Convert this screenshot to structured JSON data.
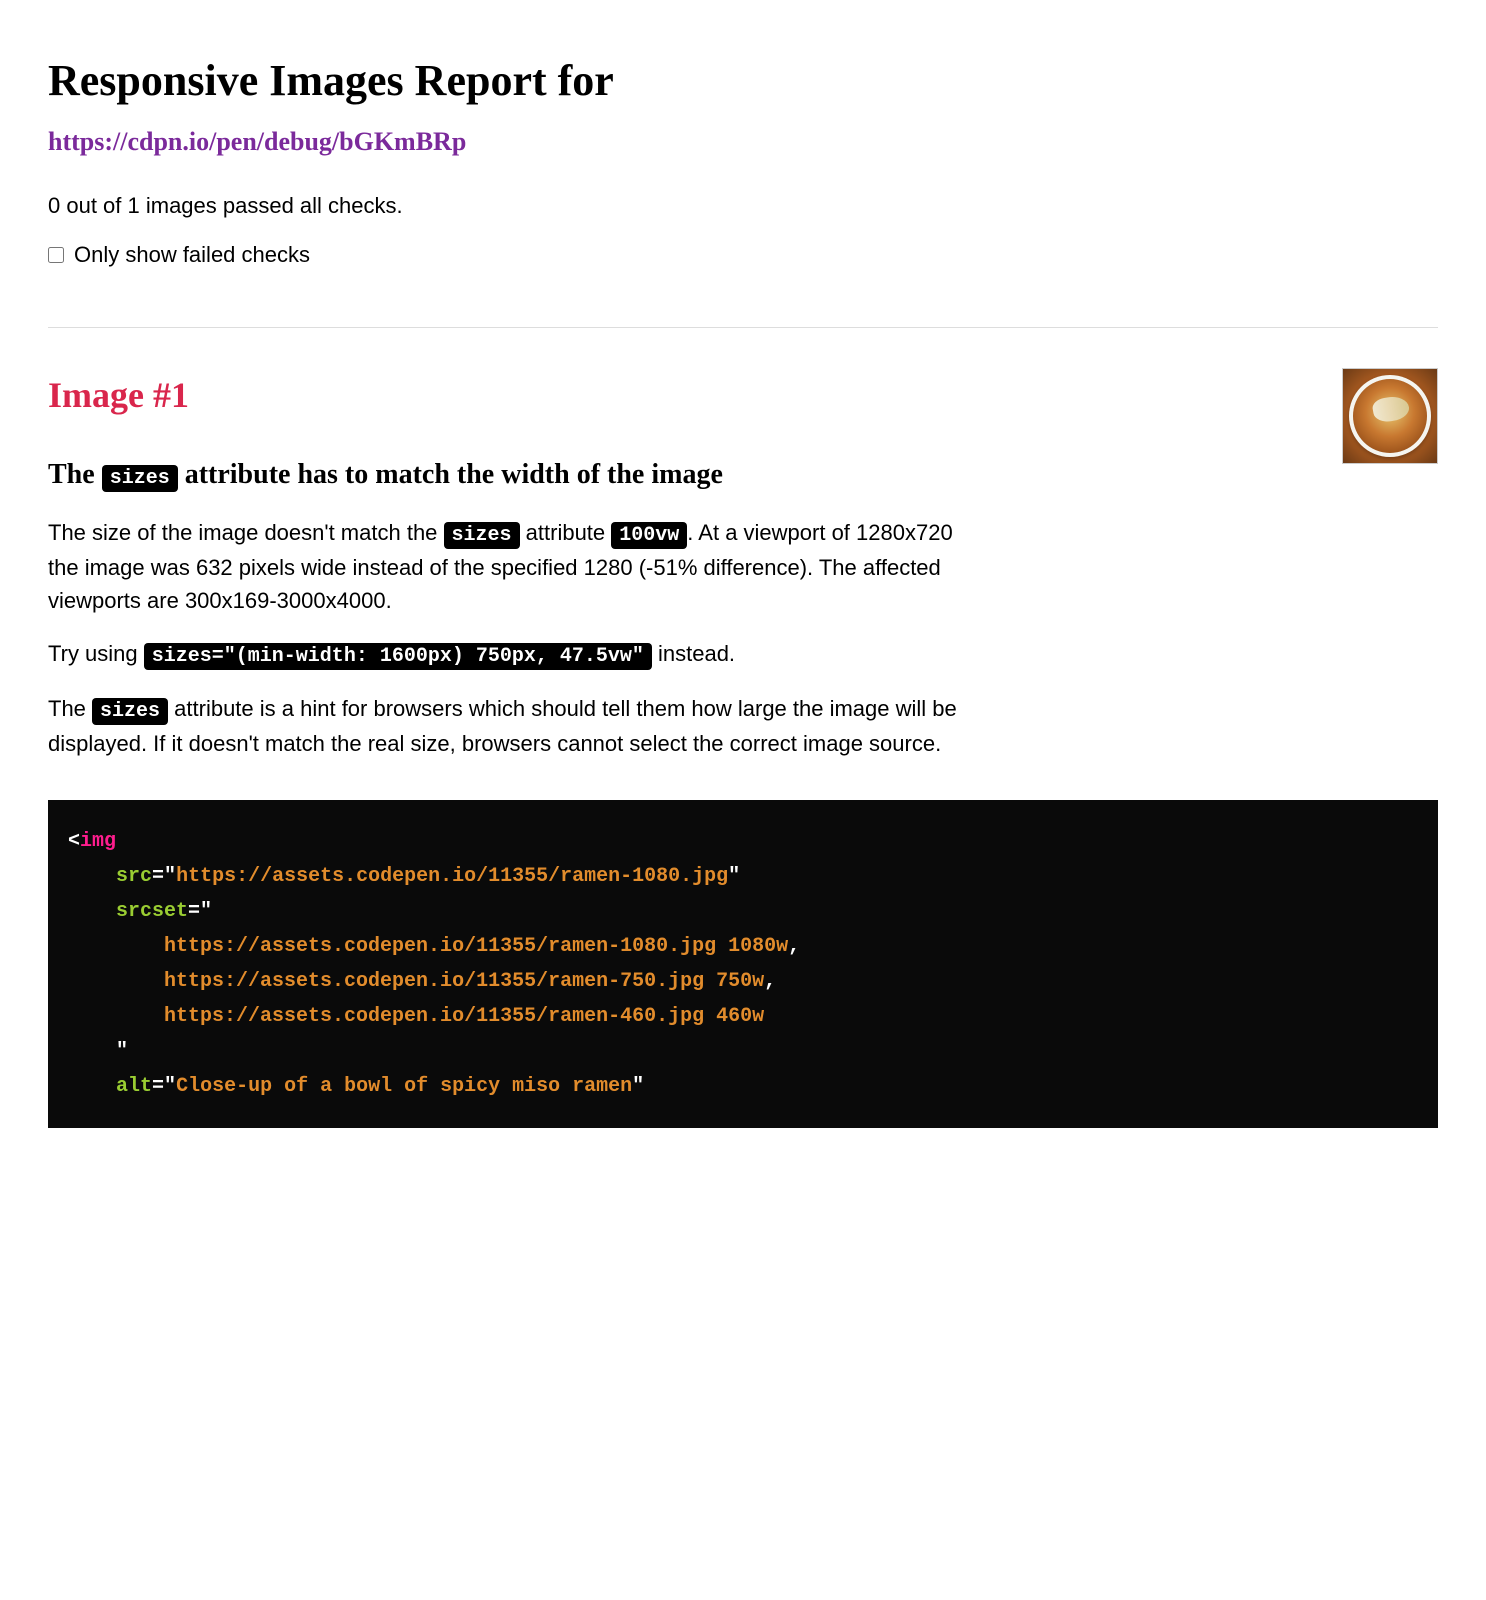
{
  "header": {
    "title": "Responsive Images Report for",
    "url": "https://cdpn.io/pen/debug/bGKmBRp"
  },
  "summary": "0 out of 1 images passed all checks.",
  "filter": {
    "label": "Only show failed checks",
    "checked": false
  },
  "image": {
    "heading": "Image #1",
    "check_title_pre": "The ",
    "check_title_code": "sizes",
    "check_title_post": " attribute has to match the width of the image",
    "p1_a": "The size of the image doesn't match the ",
    "p1_code1": "sizes",
    "p1_b": " attribute ",
    "p1_code2": "100vw",
    "p1_c": ". At a viewport of 1280x720 the image was 632 pixels wide instead of the specified 1280 (-51% difference). The affected viewports are 300x169-3000x4000.",
    "p2_a": "Try using ",
    "p2_code": "sizes=\"(min-width: 1600px) 750px, 47.5vw\"",
    "p2_b": " instead.",
    "p3_a": "The ",
    "p3_code": "sizes",
    "p3_b": " attribute is a hint for browsers which should tell them how large the image will be displayed. If it doesn't match the real size, browsers cannot select the correct image source."
  },
  "code": {
    "tag": "img",
    "src_attr": "src",
    "src_val": "https://assets.codepen.io/11355/ramen-1080.jpg",
    "srcset_attr": "srcset",
    "srcset_lines": [
      {
        "url": "https://assets.codepen.io/11355/ramen-1080.jpg",
        "w": "1080w",
        "comma": ","
      },
      {
        "url": "https://assets.codepen.io/11355/ramen-750.jpg",
        "w": "750w",
        "comma": ","
      },
      {
        "url": "https://assets.codepen.io/11355/ramen-460.jpg",
        "w": "460w",
        "comma": ""
      }
    ],
    "alt_attr": "alt",
    "alt_val": "Close-up of a bowl of spicy miso ramen"
  }
}
